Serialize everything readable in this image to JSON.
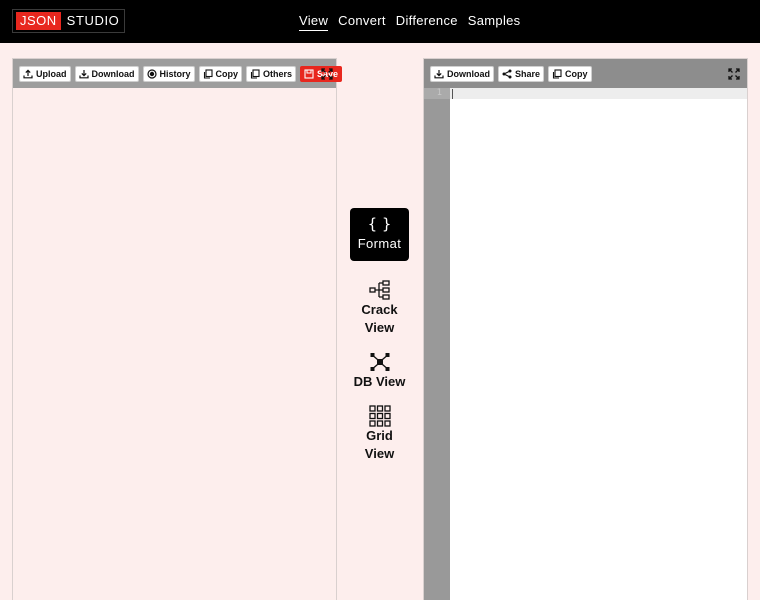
{
  "header": {
    "logo_json": "JSON",
    "logo_studio": "STUDIO",
    "nav": [
      {
        "label": "View",
        "active": true
      },
      {
        "label": "Convert"
      },
      {
        "label": "Difference"
      },
      {
        "label": "Samples"
      }
    ]
  },
  "left_toolbar": {
    "upload": "Upload",
    "download": "Download",
    "history": "History",
    "copy": "Copy",
    "others": "Others",
    "save": "Save"
  },
  "right_toolbar": {
    "download": "Download",
    "share": "Share",
    "copy": "Copy"
  },
  "output_editor": {
    "line_number": "1"
  },
  "actions": {
    "format_icon": "{ }",
    "format": "Format",
    "crack_view": [
      "Crack",
      "View"
    ],
    "db_view": "DB View",
    "grid_view": [
      "Grid",
      "View"
    ]
  },
  "colors": {
    "brand_red": "#e8271e",
    "topbar": "#000000",
    "background": "#fdeeed"
  },
  "icons": [
    "upload-icon",
    "download-icon",
    "history-icon",
    "copy-icon",
    "save-icon",
    "expand-icon",
    "share-icon",
    "tree-icon",
    "db-icon",
    "grid-icon"
  ]
}
